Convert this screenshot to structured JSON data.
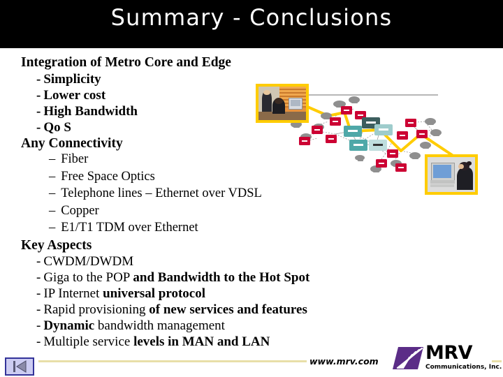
{
  "slide": {
    "title": "Summary - Conclusions",
    "title_bg": "#000000",
    "title_color": "#ffffff",
    "background": "#ffffff"
  },
  "content": {
    "sections": [
      {
        "heading": "Integration of Metro Core and Edge",
        "items": [
          {
            "bullet": "-",
            "text": "Simplicity"
          },
          {
            "bullet": "-",
            "text": "Lower cost"
          },
          {
            "bullet": "-",
            "text": "High Bandwidth"
          },
          {
            "bullet": "-",
            "text": "Qo S"
          }
        ]
      },
      {
        "heading": "Any Connectivity",
        "items": [
          {
            "bullet": "–",
            "text": "Fiber"
          },
          {
            "bullet": "–",
            "text": "Free Space Optics"
          },
          {
            "bullet": "–",
            "text": "Telephone lines – Ethernet over VDSL"
          },
          {
            "bullet": "–",
            "text": "Copper"
          },
          {
            "bullet": "–",
            "text": "E1/T1 TDM over Ethernet"
          }
        ]
      },
      {
        "heading": "Key Aspects",
        "items": [
          {
            "bullet": "-",
            "text": "CWDM/DWDM"
          },
          {
            "bullet": "-",
            "regular": "Giga to the POP ",
            "bold": "and Bandwidth to the Hot Spot"
          },
          {
            "bullet": "-",
            "regular": "IP Internet ",
            "bold": "universal protocol"
          },
          {
            "bullet": "-",
            "regular": "Rapid provisioning ",
            "bold": "of new services and features"
          },
          {
            "bullet": "-",
            "bold_first": "Dynamic",
            "regular_after": " bandwidth management"
          },
          {
            "bullet": "-",
            "regular": "Multiple service ",
            "bold": "levels in MAN and LAN"
          }
        ]
      }
    ],
    "lines": {
      "l1": "Integration of Metro Core and Edge",
      "l2": "Simplicity",
      "l3": "Lower cost",
      "l4": "High Bandwidth",
      "l5": "Qo S",
      "l6": "Any Connectivity",
      "l7": "Fiber",
      "l8": "Free Space Optics",
      "l9": "Telephone lines – Ethernet over VDSL",
      "l10": "Copper",
      "l11": "E1/T1 TDM over Ethernet",
      "l12": "Key Aspects",
      "l13": "CWDM/DWDM",
      "l14a": "Giga to the POP ",
      "l14b": "and Bandwidth to the Hot Spot",
      "l15a": "IP Internet ",
      "l15b": "universal protocol",
      "l16a": "Rapid provisioning ",
      "l16b": "of new services and features",
      "l17a": "Dynamic",
      "l17b": " bandwidth management",
      "l18a": "Multiple service ",
      "l18b": "levels in MAN and LAN"
    },
    "bullets": {
      "hyphen": "-",
      "endash": "–"
    }
  },
  "graphic": {
    "alt": "metro network topology diagram connecting two user photographs",
    "colors": {
      "path": "#FFCC00",
      "edge_node": "#CC0033",
      "core_node": "#4FA8A8",
      "core_node_dark": "#2F4F4F",
      "workstation": "#9A9A9A",
      "link": "#9A9A9A",
      "photo_border": "#FFCC00"
    },
    "photo_left_alt": "two colleagues working at an office computer",
    "photo_right_alt": "woman typing at a desktop computer"
  },
  "footer": {
    "url": "www.mrv.com",
    "rule_color": "#E8DFA8",
    "nav_prev_icon": "skip-to-start-icon",
    "nav_button_fill": "#CCCCF2",
    "nav_button_border": "#333399"
  },
  "logo": {
    "wordmark": "MRV",
    "tagline": "Communications, Inc.",
    "mark_color": "#5B2D87",
    "text_color": "#000000"
  }
}
